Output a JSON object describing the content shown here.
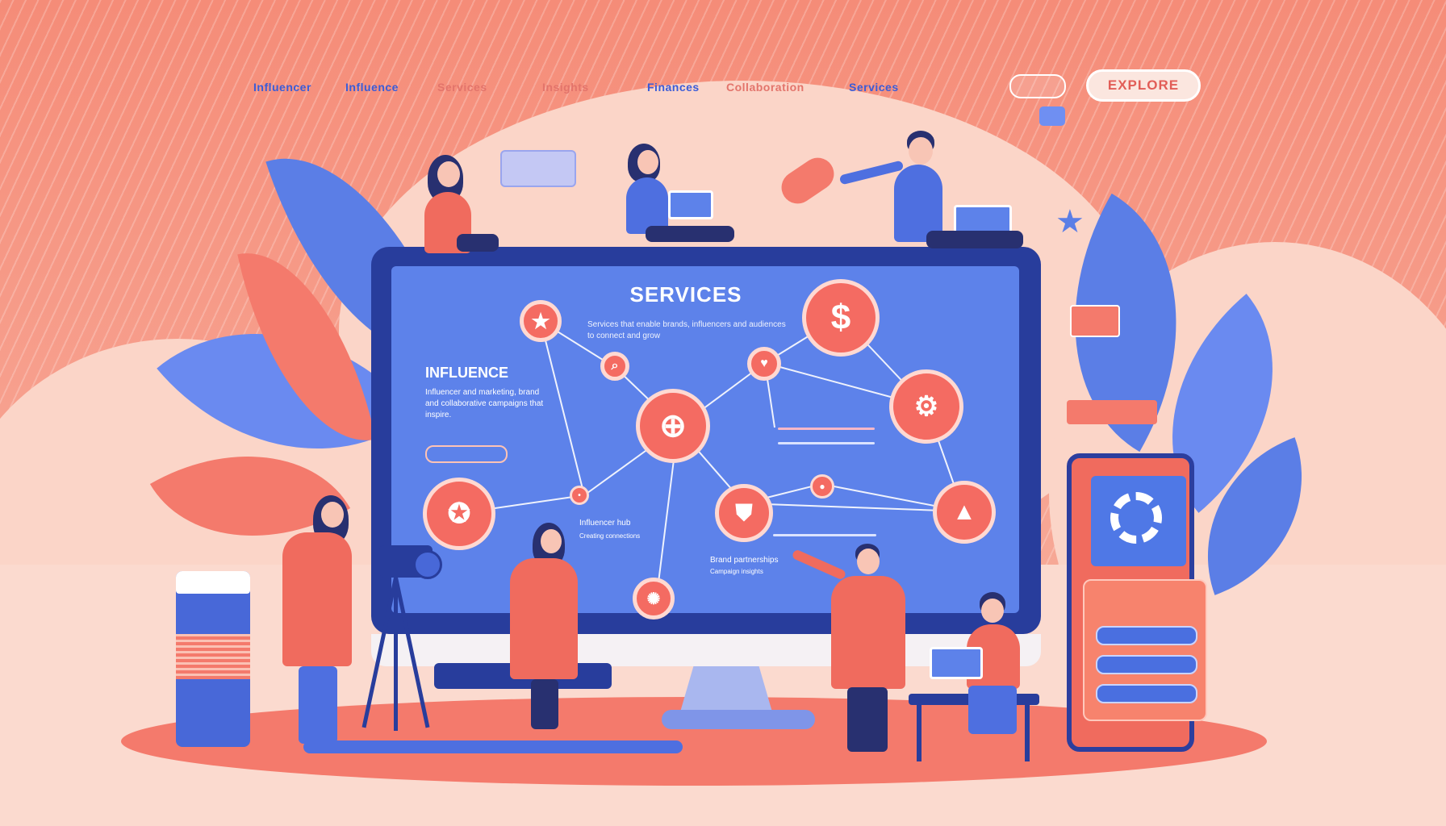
{
  "nav": {
    "items": [
      "Influencer",
      "Influence",
      "Services",
      "Insights",
      "Finances",
      "Collaboration",
      "Services"
    ],
    "cta_label": "EXPLORE"
  },
  "screen": {
    "title": "SERVICES",
    "description": "Services that enable brands, influencers and audiences to connect and grow",
    "section_title": "INFLUENCE",
    "section_text": "Influencer and marketing, brand and collaborative campaigns that inspire.",
    "node_label_1": "Influencer hub",
    "node_label_1_sub": "Creating connections",
    "node_label_2": "Brand partnerships",
    "node_label_2_sub": "Campaign insights"
  },
  "icons": {
    "star": "star-icon",
    "dollar": "dollar-icon",
    "globe": "globe-icon",
    "gear": "gear-icon",
    "search": "search-icon",
    "megaphone": "megaphone-icon",
    "badge": "badge-icon",
    "tent": "tent-icon",
    "heart": "heart-icon"
  },
  "colors": {
    "primary_blue": "#5d82ea",
    "dark_blue": "#283d9c",
    "coral": "#f46b62",
    "background": "#f6b7a6"
  }
}
